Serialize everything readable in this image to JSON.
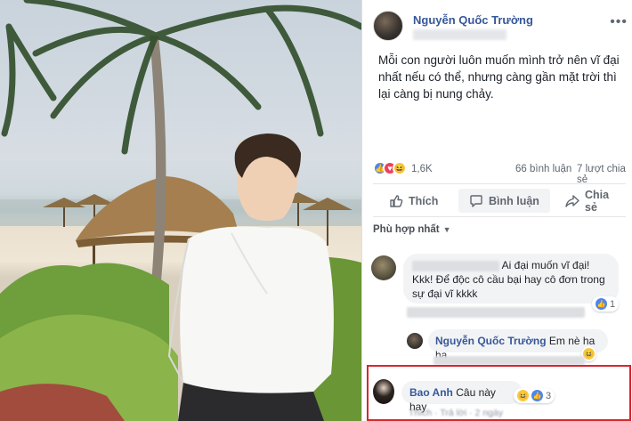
{
  "post": {
    "author_name": "Nguyễn Quốc Trường",
    "more_icon": "ellipsis-icon",
    "text": "Mỗi con người luôn muốn mình trở nên vĩ đại nhất nếu có thể, nhưng càng gần mặt trời thì lại càng bị nung chảy."
  },
  "stats": {
    "reactions": [
      "like",
      "love",
      "haha"
    ],
    "reaction_count": "1,6K",
    "comments": "66 bình luận",
    "shares": "7 lượt chia sẻ"
  },
  "actions": {
    "like": "Thích",
    "comment": "Bình luận",
    "share": "Chia sẻ"
  },
  "sort_label": "Phù hợp nhất",
  "comments": [
    {
      "text_1": "Ai đại muốn vĩ đại!",
      "text_2": "Kkk! Để độc cô cầu bại hay cô đơn trong sự đại vĩ kkkk",
      "reaction": "like",
      "reaction_count": "1"
    },
    {
      "author": "Nguyễn Quốc Trường",
      "text": "Em nè ha ha",
      "reaction": "haha"
    },
    {
      "author": "Bao Anh",
      "text": "Câu này hay",
      "reactions": [
        "haha",
        "like"
      ],
      "reaction_count": "3",
      "meta": "Thích · Trả lời · 2 ngày"
    }
  ],
  "colors": {
    "link": "#365899",
    "highlight_border": "#d8262d",
    "bubble": "#f2f3f5"
  }
}
